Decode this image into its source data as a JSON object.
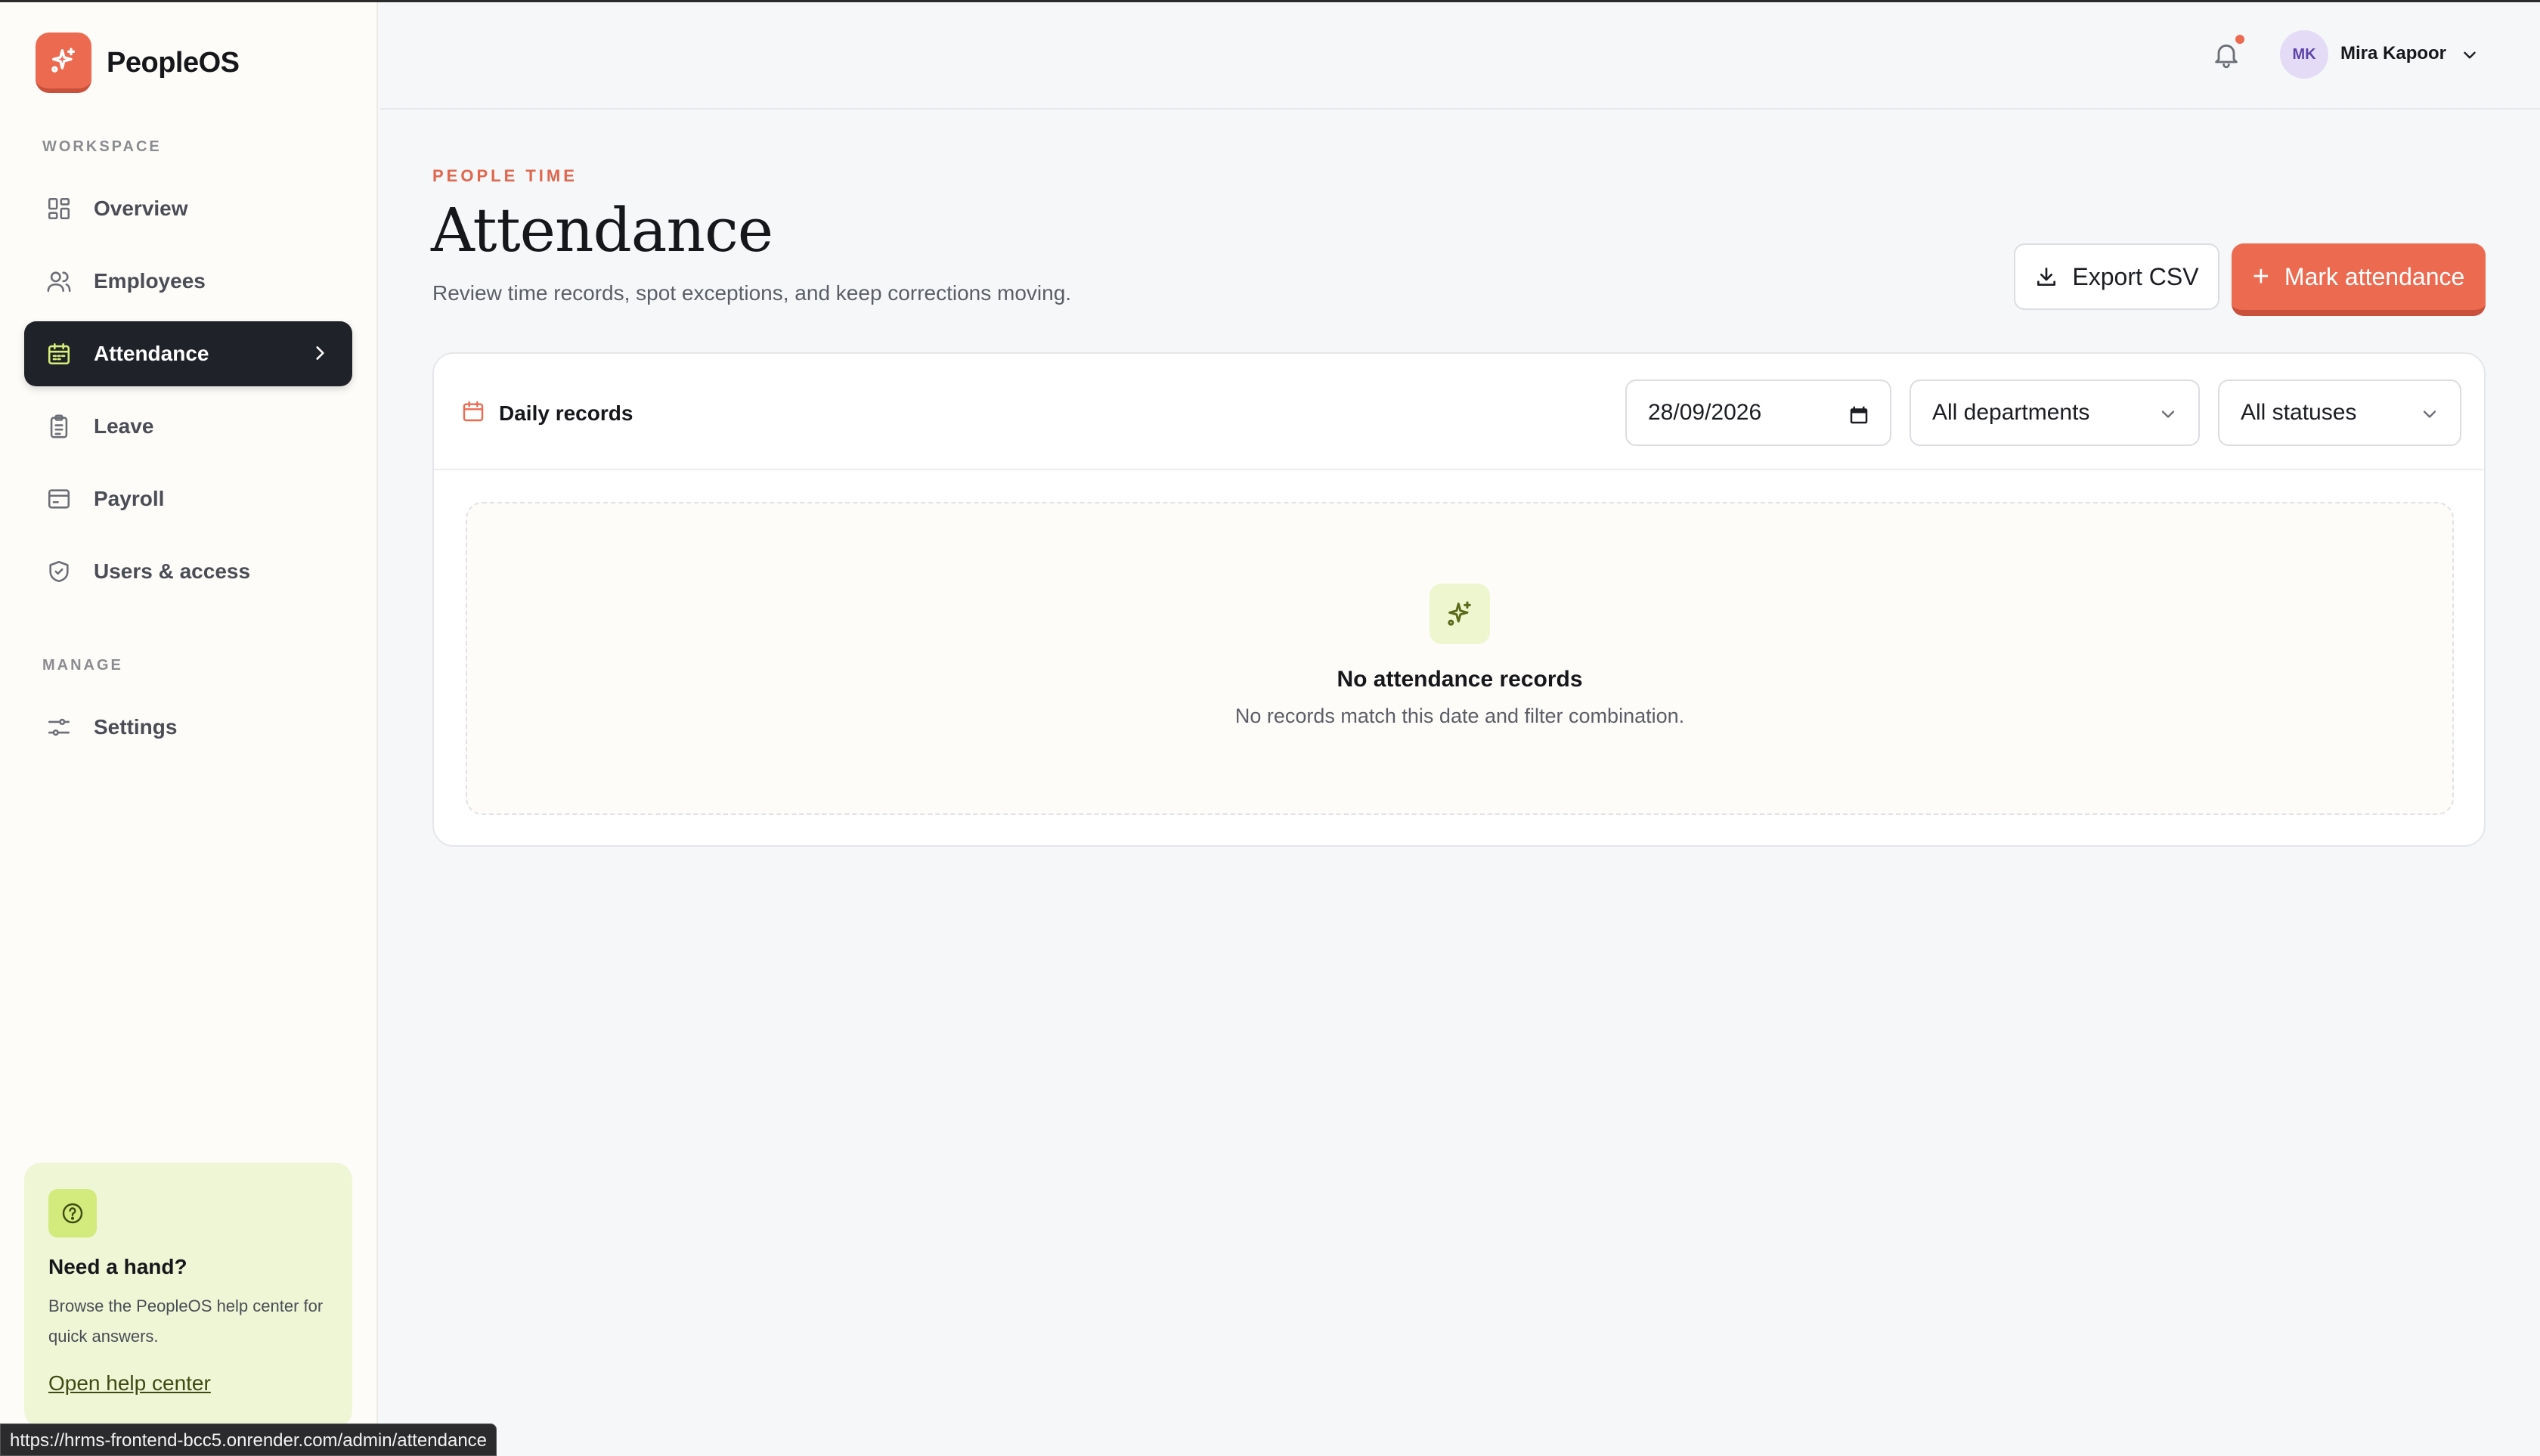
{
  "app": {
    "name": "PeopleOS",
    "logo_icon": "sparkle-icon",
    "accent_color": "#ec6a50"
  },
  "sidebar": {
    "workspace_label": "WORKSPACE",
    "manage_label": "MANAGE",
    "workspace_items": [
      {
        "label": "Overview",
        "icon": "grid-icon"
      },
      {
        "label": "Employees",
        "icon": "users-icon"
      },
      {
        "label": "Attendance",
        "icon": "calendar-icon",
        "active": true
      },
      {
        "label": "Leave",
        "icon": "clipboard-icon"
      },
      {
        "label": "Payroll",
        "icon": "wallet-icon"
      },
      {
        "label": "Users & access",
        "icon": "shield-icon"
      }
    ],
    "manage_items": [
      {
        "label": "Settings",
        "icon": "sliders-icon"
      }
    ],
    "help": {
      "title": "Need a hand?",
      "description": "Browse the PeopleOS help center for quick answers.",
      "link": "Open help center"
    }
  },
  "header": {
    "notification_icon": "bell-icon",
    "has_notification": true,
    "user": {
      "initials": "MK",
      "name": "Mira Kapoor"
    }
  },
  "page": {
    "eyebrow": "PEOPLE TIME",
    "title": "Attendance",
    "subtitle": "Review time records, spot exceptions, and keep corrections moving.",
    "export_label": "Export CSV",
    "mark_label": "Mark attendance"
  },
  "records": {
    "title": "Daily records",
    "date_value": "28/09/2026",
    "department_value": "All departments",
    "status_value": "All statuses",
    "empty_title": "No attendance records",
    "empty_desc": "No records match this date and filter combination."
  },
  "browser": {
    "status_url": "https://hrms-frontend-bcc5.onrender.com/admin/attendance"
  }
}
